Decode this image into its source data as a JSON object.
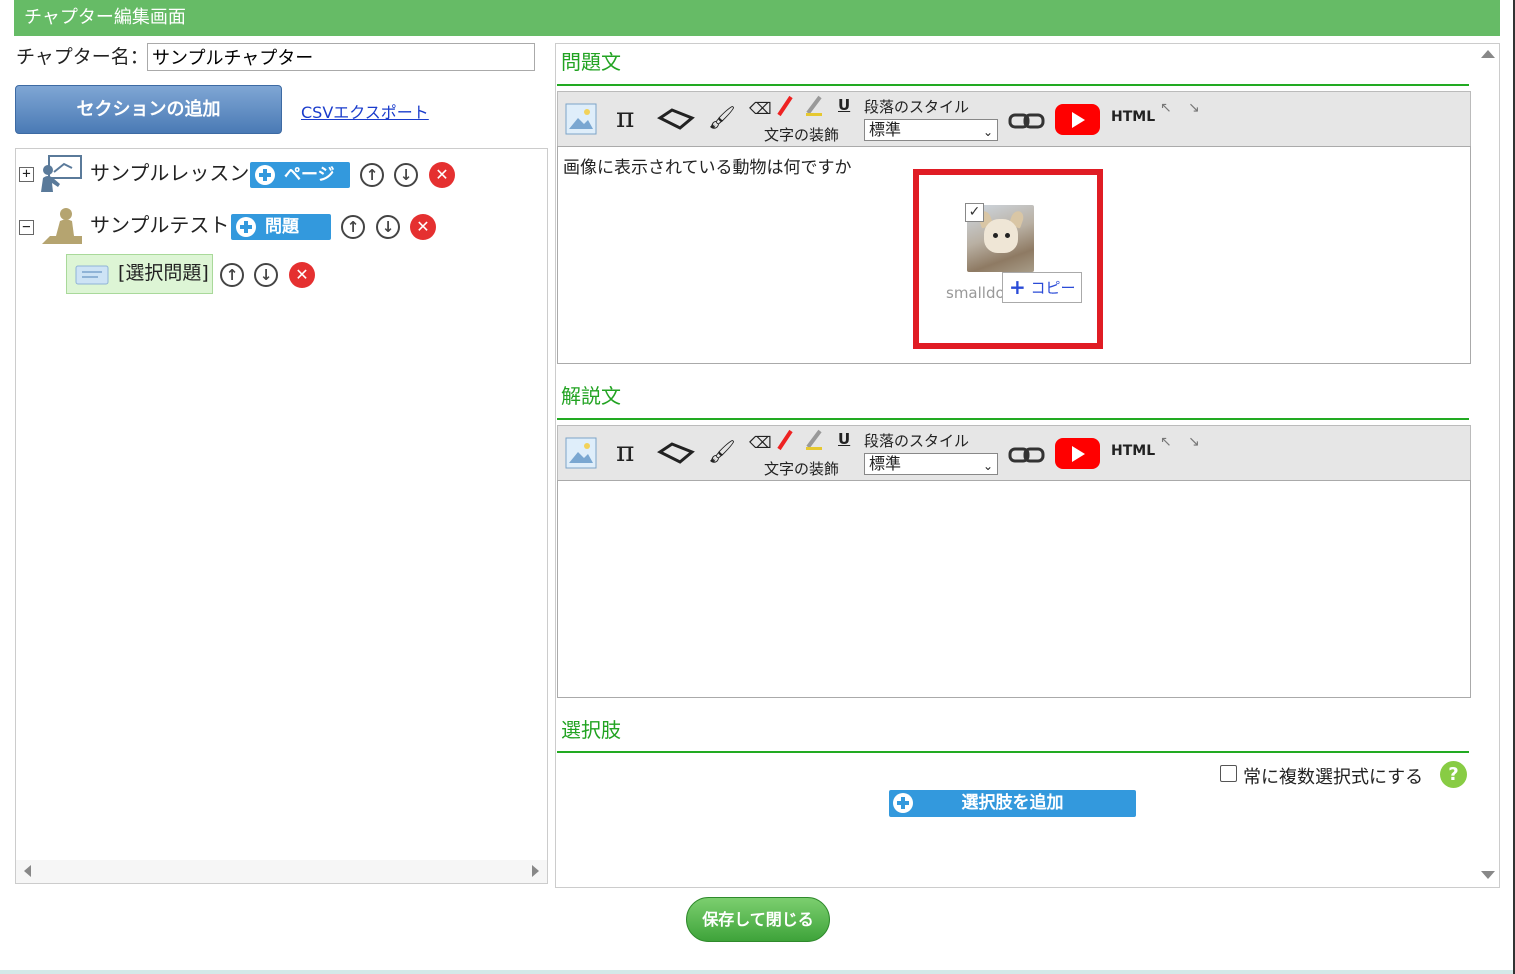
{
  "header": {
    "title": "チャプター編集画面"
  },
  "chapter": {
    "name_label": "チャプター名：",
    "name_value": "サンプルチャプター"
  },
  "actions": {
    "add_section": "セクションの追加",
    "csv_export": "CSVエクスポート"
  },
  "tree": {
    "lesson": {
      "label": "サンプルレッスン",
      "add_button": "ページ"
    },
    "test": {
      "label": "サンプルテスト",
      "add_button": "問題"
    },
    "question_item": {
      "label": "[選択問題]"
    }
  },
  "question_section": {
    "heading": "問題文",
    "body_text": "画像に表示されている動物は何ですか",
    "attachment": {
      "filename": "smalldo",
      "copy_label": "コピー"
    }
  },
  "explanation_section": {
    "heading": "解説文"
  },
  "toolbar": {
    "decoration_label": "文字の装飾",
    "paragraph_label": "段落のスタイル",
    "paragraph_value": "標準",
    "html_label": "HTML",
    "underline_label": "U",
    "pi_label": "π"
  },
  "choices_section": {
    "heading": "選択肢",
    "multi_select_label": "常に複数選択式にする",
    "add_choice": "選択肢を追加"
  },
  "footer": {
    "save_close": "保存して閉じる"
  }
}
